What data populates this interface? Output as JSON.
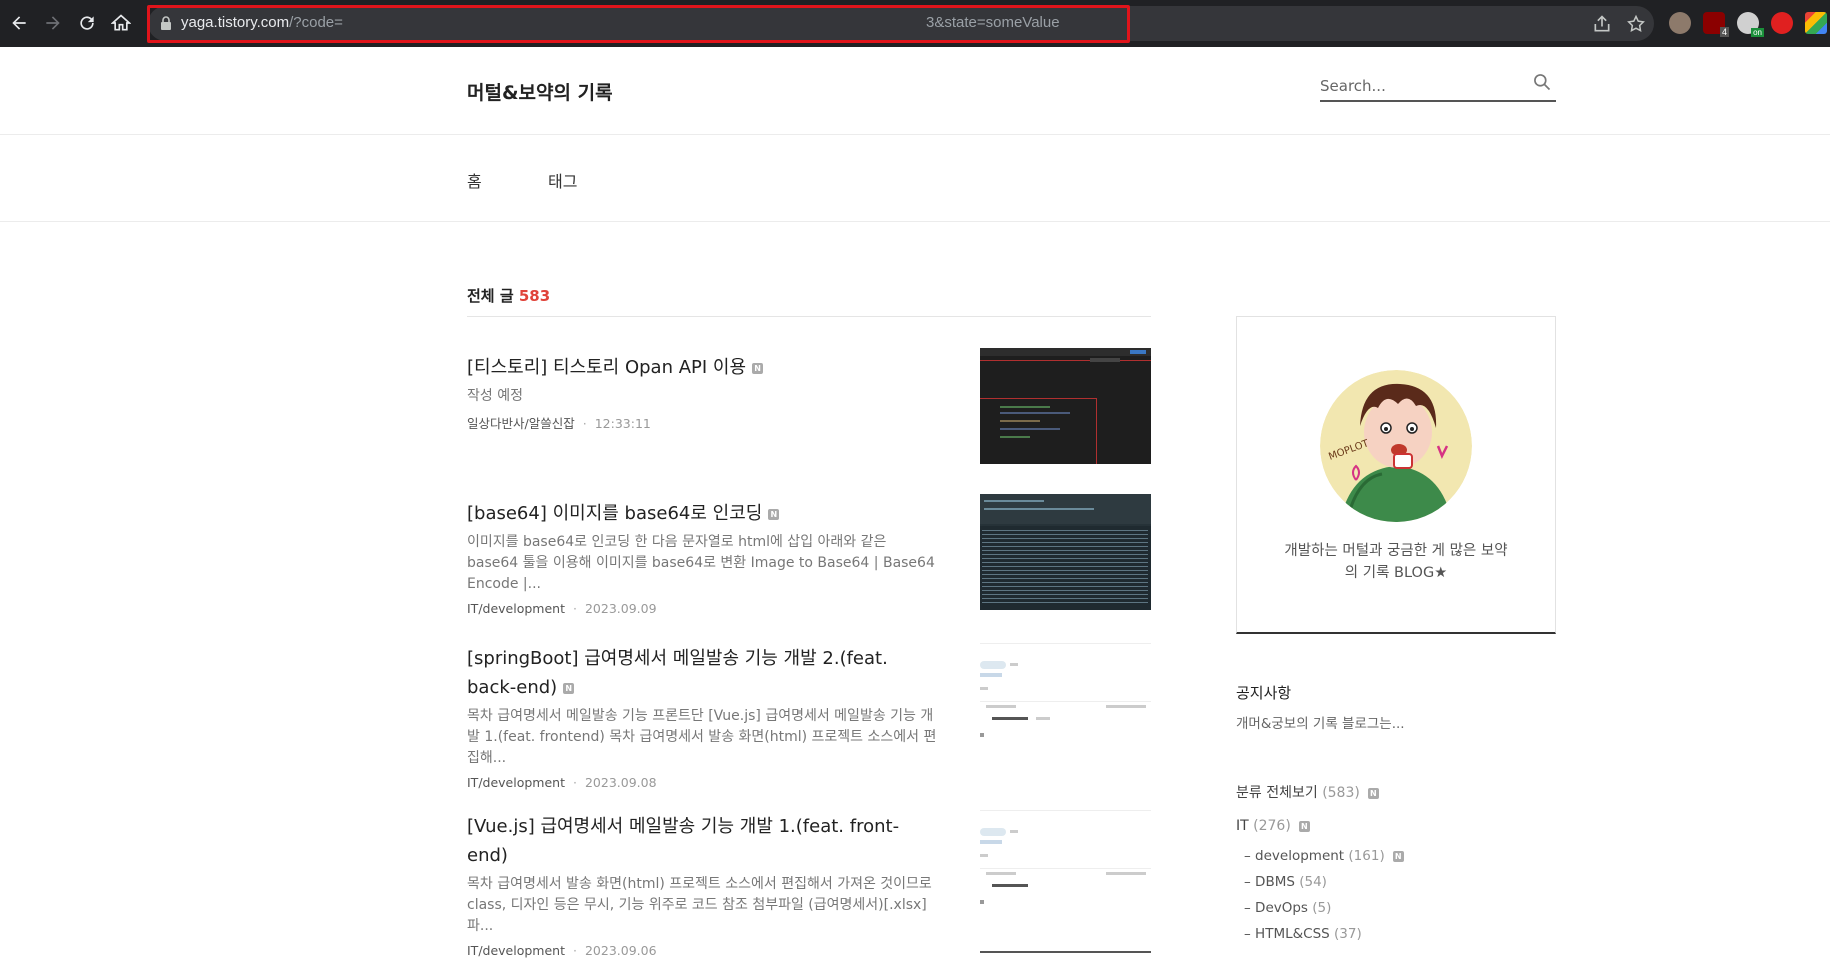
{
  "browser": {
    "url_host": "yaga.tistory.com",
    "url_path": "/?code=",
    "url_tail": "3&state=someValue",
    "ext_badge_1": "4",
    "ext_badge_2": "on"
  },
  "blog": {
    "title": "머털&보약의 기록",
    "search_placeholder": "Search...",
    "menu": [
      {
        "label": "홈"
      },
      {
        "label": "태그"
      }
    ]
  },
  "main": {
    "all_label": "전체 글",
    "all_count": "583",
    "posts": [
      {
        "title": "[티스토리] 티스토리 Opan API 이용",
        "summary": "작성 예정",
        "category": "일상다반사/알쓸신잡",
        "date": "12:33:11"
      },
      {
        "title": "[base64] 이미지를 base64로 인코딩",
        "summary": "이미지를 base64로 인코딩 한 다음 문자열로 html에 삽입 아래와 같은 base64 툴을 이용해 이미지를 base64로 변환 Image to Base64 | Base64 Encode |...",
        "category": "IT/development",
        "date": "2023.09.09"
      },
      {
        "title": "[springBoot] 급여명세서 메일발송 기능 개발 2.(feat. back-end)",
        "summary": "목차 급여명세서 메일발송 기능 프론트단 [Vue.js] 급여명세서 메일발송 기능 개발 1.(feat. frontend) 목차 급여명세서 발송 화면(html) 프로젝트 소스에서 편집해...",
        "category": "IT/development",
        "date": "2023.09.08"
      },
      {
        "title": "[Vue.js] 급여명세서 메일발송 기능 개발 1.(feat. front-end)",
        "summary": "목차 급여명세서 발송 화면(html) 프로젝트 소스에서 편집해서 가져온 것이므로 class, 디자인 등은 무시, 기능 위주로 코드 참조 첨부파일 (급여명세서)[.xlsx] 파...",
        "category": "IT/development",
        "date": "2023.09.06"
      }
    ]
  },
  "sidebar": {
    "profile_desc": "개발하는 머털과 궁금한 게 많은 보약의 기록 BLOG★",
    "notice_title": "공지사항",
    "notice_text": "개머&궁보의 기록 블로그는...",
    "category_all": "분류 전체보기",
    "category_all_count": "(583)",
    "category_it": "IT",
    "category_it_count": "(276)",
    "subcats": [
      {
        "name": "development",
        "count": "(161)"
      },
      {
        "name": "DBMS",
        "count": "(54)"
      },
      {
        "name": "DevOps",
        "count": "(5)"
      },
      {
        "name": "HTML&CSS",
        "count": "(37)"
      }
    ],
    "badge_letter": "N",
    "dash": "–"
  },
  "colors": {
    "accent": "#e0433a",
    "chrome_bg": "#202124",
    "highlight": "#e0141b"
  }
}
